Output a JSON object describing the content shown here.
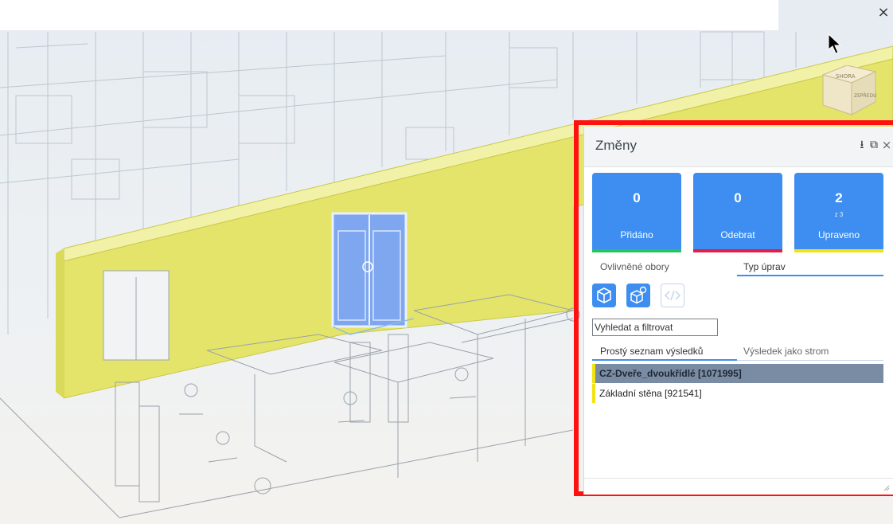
{
  "window": {
    "close_glyph": "×"
  },
  "panel": {
    "title": "Změny",
    "header_icons": {
      "download": "⭳",
      "popout": "⧉",
      "close": "×"
    },
    "stats": [
      {
        "value": "0",
        "label": "Přidáno",
        "sub": "",
        "accent": "#22c55e"
      },
      {
        "value": "0",
        "label": "Odebrat",
        "sub": "",
        "accent": "#e11d48"
      },
      {
        "value": "2",
        "label": "Upraveno",
        "sub": "z 3",
        "accent": "#f2e311"
      }
    ],
    "tabs_top": [
      "Ovlivněné obory",
      "Typ úprav"
    ],
    "search_placeholder": "Vyhledat a filtrovat",
    "tabs_results": [
      "Prostý seznam výsledků",
      "Výsledek jako strom"
    ],
    "results": [
      {
        "label": "CZ-Dveře_dvoukřídlé [1071995]",
        "selected": true,
        "color": "#f2e311"
      },
      {
        "label": "Základní stěna [921541]",
        "selected": false,
        "color": "#f2e311"
      }
    ]
  },
  "viewcube": {
    "top_label": "SHORA",
    "front_label": "ZEPŘEDU"
  },
  "colors": {
    "accent_blue": "#3d8ef0",
    "highlight_red": "#ff1111",
    "wall_yellow": "#e4e46a",
    "selected_row": "#7a8ca3"
  }
}
